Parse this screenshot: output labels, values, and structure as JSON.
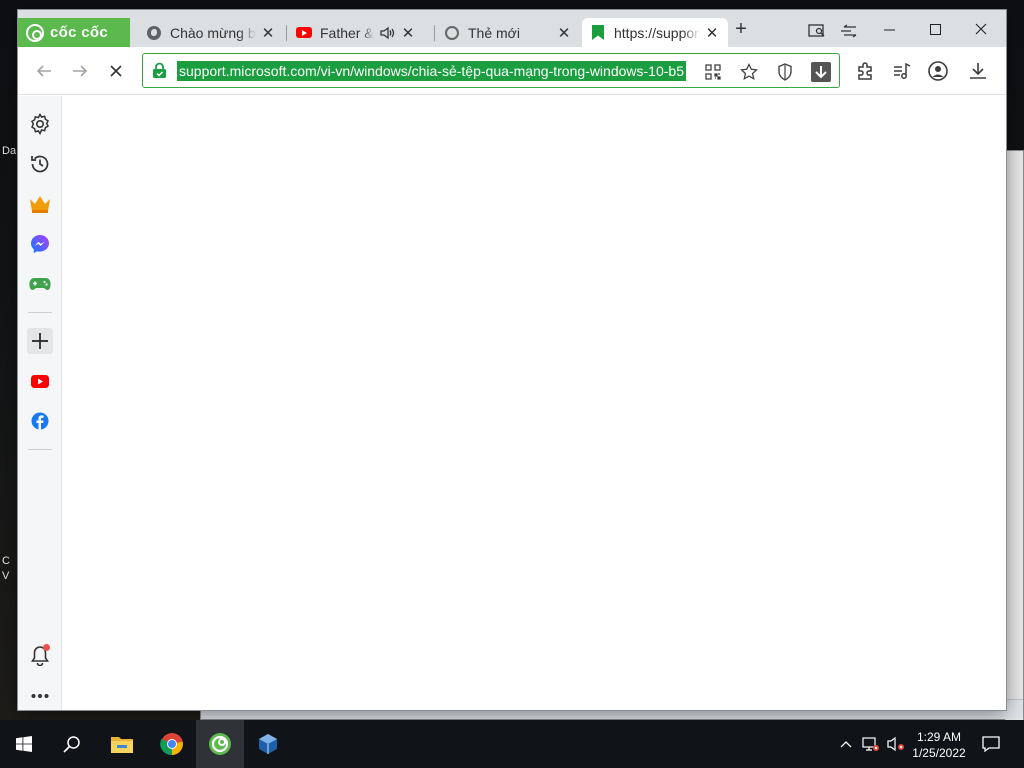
{
  "desktop": {
    "fragments": [
      "Da",
      "C",
      "V"
    ]
  },
  "browser": {
    "brand": "cốc cốc",
    "tabs": [
      {
        "title": "Chào mừng bạn",
        "favicon": "globe-icon"
      },
      {
        "title": "Father & Son",
        "favicon": "youtube-icon",
        "audio": true
      },
      {
        "title": "Thẻ mới",
        "favicon": "coccoc-icon"
      },
      {
        "title": "https://support.microsoft.com",
        "favicon": "flag-icon",
        "active": true
      }
    ],
    "new_tab_label": "+",
    "url": "support.microsoft.com/vi-vn/windows/chia-sẻ-tệp-qua-mạng-trong-windows-10-b5",
    "loading": true
  },
  "sidebar": {
    "items": [
      "settings-icon",
      "history-icon",
      "crown-icon",
      "messenger-icon",
      "gamepad-icon",
      "add-icon",
      "youtube-icon",
      "facebook-icon",
      "notification-icon",
      "more-icon"
    ],
    "notification_badge": true
  },
  "taskbar": {
    "apps": [
      "file-explorer-icon",
      "chrome-icon",
      "coccoc-icon",
      "virtualbox-icon"
    ],
    "time": "1:29 AM",
    "date": "1/25/2022"
  },
  "colors": {
    "accent": "#1a9e3f",
    "brand_green": "#5cb94e",
    "taskbar": "#101317"
  }
}
